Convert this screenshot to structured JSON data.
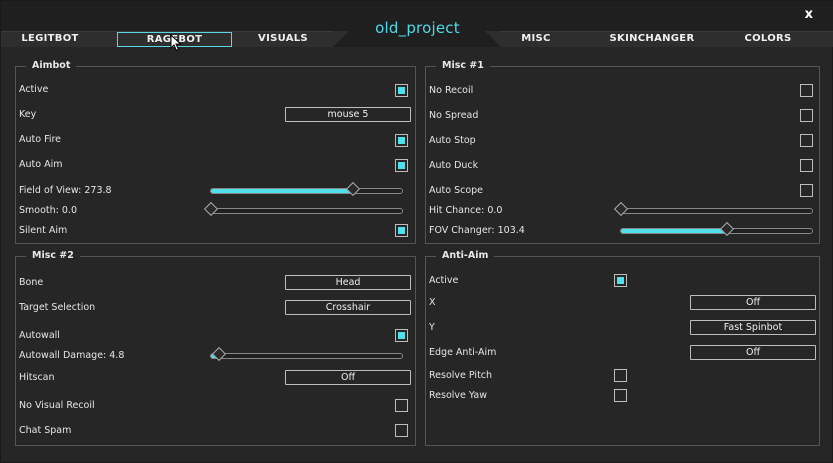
{
  "window": {
    "title": "old_project",
    "close_label": "x"
  },
  "tabs": [
    {
      "label": "LEGITBOT"
    },
    {
      "label": "RAGEBOT"
    },
    {
      "label": "VISUALS"
    },
    {
      "label": "MISC"
    },
    {
      "label": "SKINCHANGER"
    },
    {
      "label": "COLORS"
    }
  ],
  "active_tab": "RAGEBOT",
  "accent_color": "#4fe0ec",
  "aimbot": {
    "title": "Aimbot",
    "active": {
      "label": "Active",
      "checked": true
    },
    "key": {
      "label": "Key",
      "value": "mouse 5"
    },
    "auto_fire": {
      "label": "Auto Fire",
      "checked": true
    },
    "auto_aim": {
      "label": "Auto Aim",
      "checked": true
    },
    "fov": {
      "label": "Field of View: 273.8",
      "fraction": 0.75
    },
    "smooth": {
      "label": "Smooth: 0.0",
      "fraction": 0.0
    },
    "silent_aim": {
      "label": "Silent Aim",
      "checked": true
    }
  },
  "misc1": {
    "title": "Misc #1",
    "no_recoil": {
      "label": "No Recoil",
      "checked": false
    },
    "no_spread": {
      "label": "No Spread",
      "checked": false
    },
    "auto_stop": {
      "label": "Auto Stop",
      "checked": false
    },
    "auto_duck": {
      "label": "Auto Duck",
      "checked": false
    },
    "auto_scope": {
      "label": "Auto Scope",
      "checked": false
    },
    "hit_chance": {
      "label": "Hit Chance: 0.0",
      "fraction": 0.0
    },
    "fov_changer": {
      "label": "FOV Changer: 103.4",
      "fraction": 0.56
    }
  },
  "misc2": {
    "title": "Misc #2",
    "bone": {
      "label": "Bone",
      "value": "Head"
    },
    "target_selection": {
      "label": "Target Selection",
      "value": "Crosshair"
    },
    "autowall": {
      "label": "Autowall",
      "checked": true
    },
    "autowall_damage": {
      "label": "Autowall Damage: 4.8",
      "fraction": 0.04
    },
    "hitscan": {
      "label": "Hitscan",
      "value": "Off"
    },
    "no_visual_recoil": {
      "label": "No Visual Recoil",
      "checked": false
    },
    "chat_spam": {
      "label": "Chat Spam",
      "checked": false
    }
  },
  "anti_aim": {
    "title": "Anti-Aim",
    "active": {
      "label": "Active",
      "checked": true
    },
    "x": {
      "label": "X",
      "value": "Off"
    },
    "y": {
      "label": "Y",
      "value": "Fast Spinbot"
    },
    "edge": {
      "label": "Edge Anti-Aim",
      "value": "Off"
    },
    "resolve_pitch": {
      "label": "Resolve Pitch",
      "checked": false
    },
    "resolve_yaw": {
      "label": "Resolve Yaw",
      "checked": false
    }
  }
}
